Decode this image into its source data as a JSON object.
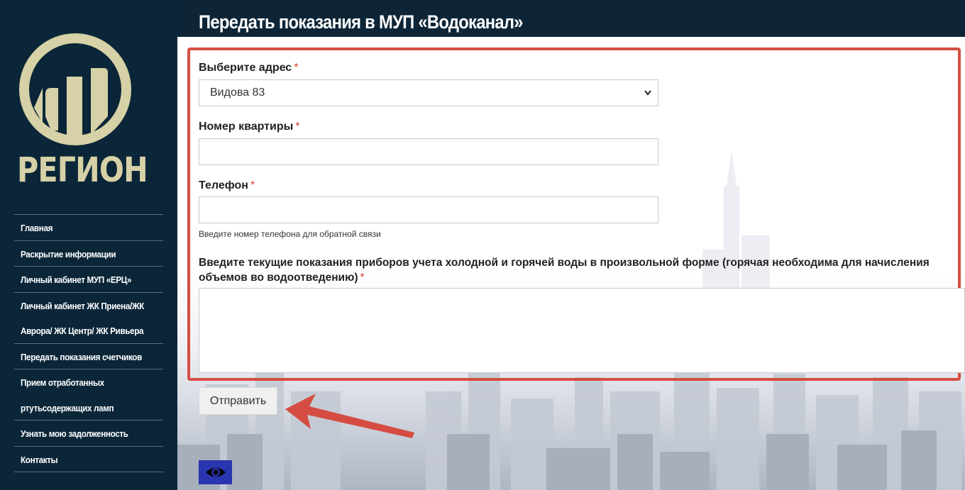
{
  "logo": {
    "text": "РЕГИОН"
  },
  "nav": {
    "items": [
      {
        "lines": [
          "Главная"
        ]
      },
      {
        "lines": [
          "Раскрытие информации"
        ]
      },
      {
        "lines": [
          "Личный кабинет МУП «ЕРЦ»"
        ]
      },
      {
        "lines": [
          "Личный кабинет ЖК Приена/ЖК",
          "Аврора/ ЖК Центр/ ЖК Ривьера"
        ]
      },
      {
        "lines": [
          "Передать показания счетчиков"
        ]
      },
      {
        "lines": [
          "Прием отработанных",
          "ртутьсодержащих ламп"
        ]
      },
      {
        "lines": [
          "Узнать мою задолженность"
        ]
      },
      {
        "lines": [
          "Контакты"
        ]
      }
    ]
  },
  "page": {
    "title": "Передать показания в МУП «Водоканал»"
  },
  "form": {
    "required_mark": "*",
    "address": {
      "label": "Выберите адрес",
      "value": "Видова 83"
    },
    "apartment": {
      "label": "Номер квартиры",
      "value": ""
    },
    "phone": {
      "label": "Телефон",
      "value": "",
      "help": "Введите номер телефона для обратной связи"
    },
    "readings": {
      "label_line1": "Введите текущие показания приборов учета холодной и горячей воды в произвольной форме (горячая необходима для начисления",
      "label_line2": "объемов во водоотведению)",
      "value": ""
    },
    "submit_label": "Отправить"
  },
  "icons": {
    "accessibility": "eye-icon",
    "dropdown": "chevron-down-icon"
  },
  "colors": {
    "sidebar": "#0b2638",
    "highlight": "#d54d42",
    "accessibility_button": "#2a35b0",
    "logo": "#d6d1a6"
  }
}
